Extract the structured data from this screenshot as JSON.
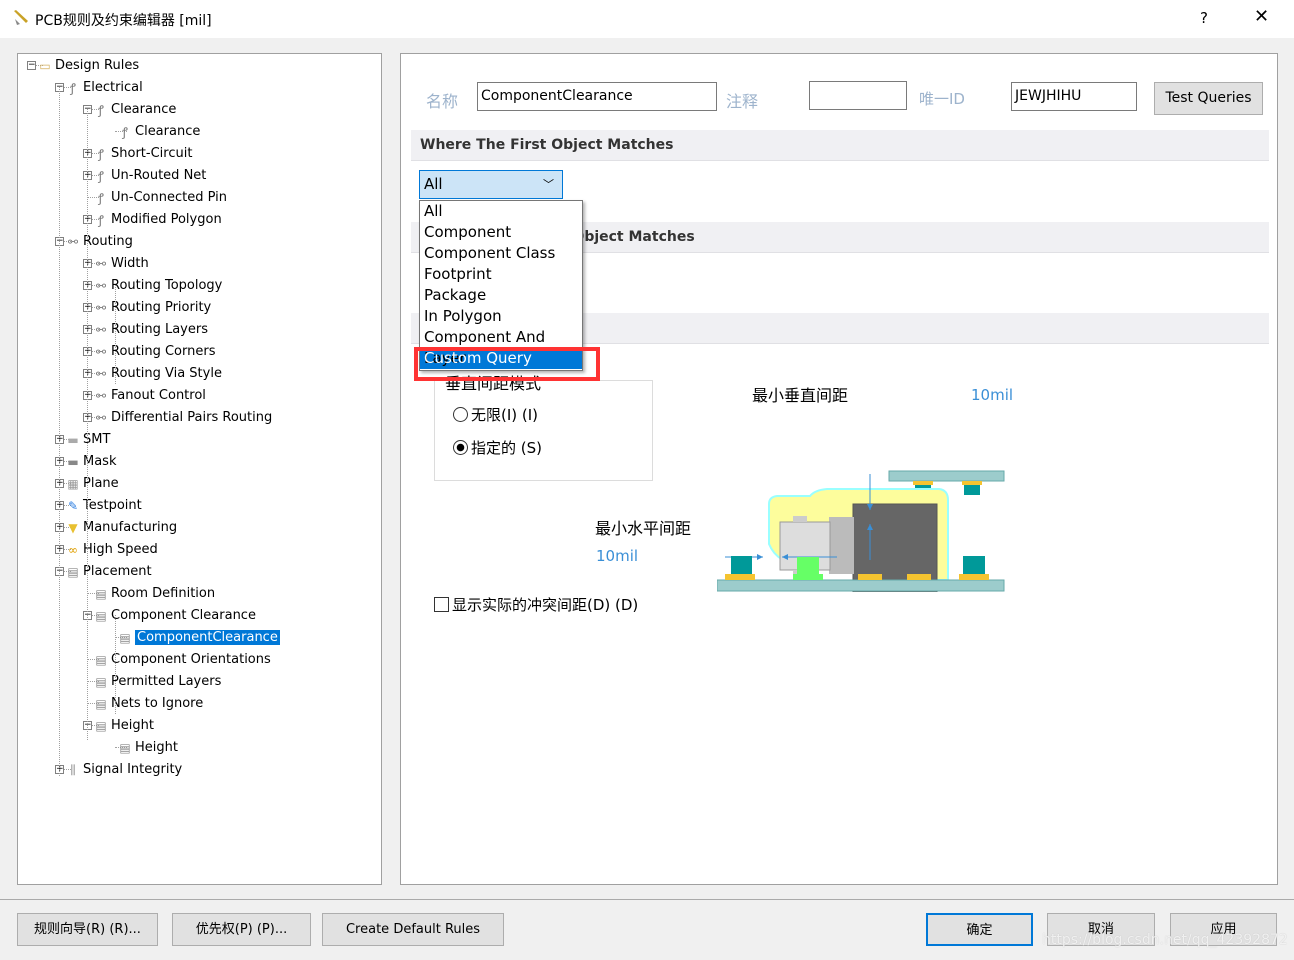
{
  "window": {
    "title": "PCB规则及约束编辑器 [mil]",
    "help": "?",
    "close": "✕"
  },
  "tree": [
    {
      "level": 0,
      "label": "Design Rules",
      "exp": "-",
      "icon": "folder"
    },
    {
      "level": 1,
      "label": "Electrical",
      "exp": "-",
      "icon": "electrical"
    },
    {
      "level": 2,
      "label": "Clearance",
      "exp": "-",
      "icon": "electrical"
    },
    {
      "level": 3,
      "label": "Clearance",
      "exp": "",
      "icon": "electrical"
    },
    {
      "level": 2,
      "label": "Short-Circuit",
      "exp": "+",
      "icon": "electrical"
    },
    {
      "level": 2,
      "label": "Un-Routed Net",
      "exp": "+",
      "icon": "electrical"
    },
    {
      "level": 2,
      "label": "Un-Connected Pin",
      "exp": "",
      "icon": "electrical"
    },
    {
      "level": 2,
      "label": "Modified Polygon",
      "exp": "+",
      "icon": "electrical"
    },
    {
      "level": 1,
      "label": "Routing",
      "exp": "-",
      "icon": "routing"
    },
    {
      "level": 2,
      "label": "Width",
      "exp": "+",
      "icon": "routing"
    },
    {
      "level": 2,
      "label": "Routing Topology",
      "exp": "+",
      "icon": "routing"
    },
    {
      "level": 2,
      "label": "Routing Priority",
      "exp": "+",
      "icon": "routing"
    },
    {
      "level": 2,
      "label": "Routing Layers",
      "exp": "+",
      "icon": "routing"
    },
    {
      "level": 2,
      "label": "Routing Corners",
      "exp": "+",
      "icon": "routing"
    },
    {
      "level": 2,
      "label": "Routing Via Style",
      "exp": "+",
      "icon": "routing"
    },
    {
      "level": 2,
      "label": "Fanout Control",
      "exp": "+",
      "icon": "routing"
    },
    {
      "level": 2,
      "label": "Differential Pairs Routing",
      "exp": "+",
      "icon": "routing"
    },
    {
      "level": 1,
      "label": "SMT",
      "exp": "+",
      "icon": "smt"
    },
    {
      "level": 1,
      "label": "Mask",
      "exp": "+",
      "icon": "mask"
    },
    {
      "level": 1,
      "label": "Plane",
      "exp": "+",
      "icon": "plane"
    },
    {
      "level": 1,
      "label": "Testpoint",
      "exp": "+",
      "icon": "testpoint"
    },
    {
      "level": 1,
      "label": "Manufacturing",
      "exp": "+",
      "icon": "manufacturing"
    },
    {
      "level": 1,
      "label": "High Speed",
      "exp": "+",
      "icon": "highspeed"
    },
    {
      "level": 1,
      "label": "Placement",
      "exp": "-",
      "icon": "placement"
    },
    {
      "level": 2,
      "label": "Room Definition",
      "exp": "",
      "icon": "placement"
    },
    {
      "level": 2,
      "label": "Component Clearance",
      "exp": "-",
      "icon": "placement"
    },
    {
      "level": 3,
      "label": "ComponentClearance",
      "exp": "",
      "icon": "placement",
      "selected": true
    },
    {
      "level": 2,
      "label": "Component Orientations",
      "exp": "",
      "icon": "placement"
    },
    {
      "level": 2,
      "label": "Permitted Layers",
      "exp": "",
      "icon": "placement"
    },
    {
      "level": 2,
      "label": "Nets to Ignore",
      "exp": "",
      "icon": "placement"
    },
    {
      "level": 2,
      "label": "Height",
      "exp": "-",
      "icon": "placement"
    },
    {
      "level": 3,
      "label": "Height",
      "exp": "",
      "icon": "placement"
    },
    {
      "level": 1,
      "label": "Signal Integrity",
      "exp": "+",
      "icon": "signal"
    }
  ],
  "header": {
    "name_label": "名称",
    "name_value": "ComponentClearance",
    "comment_label": "注释",
    "comment_value": "",
    "uid_label": "唯一ID",
    "uid_value": "JEWJHIHU",
    "test_queries": "Test Queries"
  },
  "sections": {
    "first": "Where The First Object Matches",
    "second": "Where The Second Object Matches",
    "third": ""
  },
  "dropdown": {
    "selected": "All",
    "options": [
      "All",
      "Component",
      "Component Class",
      "Footprint",
      "Package",
      "In Polygon",
      "Component And Layer",
      "Custom Query"
    ],
    "highlighted": 7
  },
  "constraints": {
    "group_label": "垂直间距模式",
    "radio_infinite": "无限(I) (I)",
    "radio_specified": "指定的 (S)",
    "selected_mode": "specified",
    "min_vertical_label": "最小垂直间距",
    "min_vertical_value": "10mil",
    "min_horizontal_label": "最小水平间距",
    "min_horizontal_value": "10mil",
    "show_actual_label": "显示实际的冲突间距(D) (D)",
    "show_actual_checked": false
  },
  "footer": {
    "rule_wizard": "规则向导(R) (R)...",
    "priorities": "优先权(P) (P)...",
    "create_default": "Create Default Rules",
    "ok": "确定",
    "cancel": "取消",
    "apply": "应用"
  },
  "watermark": "https://blog.csdn.net/qq_42392872",
  "colors": {
    "selection": "#0078d7",
    "highlight_box": "#ff3333",
    "value_blue": "#3a8fd6"
  }
}
